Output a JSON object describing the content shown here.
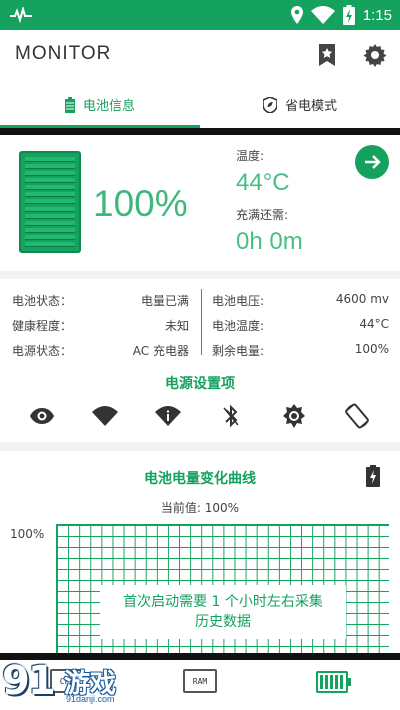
{
  "statusbar": {
    "time": "1:15"
  },
  "toolbar": {
    "app_title": "MONITOR"
  },
  "tabs": [
    {
      "label": "电池信息",
      "icon": "battery-icon",
      "active": true
    },
    {
      "label": "省电模式",
      "icon": "shield-leaf-icon",
      "active": false
    }
  ],
  "battery_card": {
    "level": "100%",
    "level_fraction": 1.0,
    "temp_label": "温度:",
    "temp_value": "44°C",
    "full_label": "充满还需:",
    "full_value": "0h 0m"
  },
  "info": {
    "left": [
      {
        "label": "电池状态：",
        "value": "电量已满"
      },
      {
        "label": "健康程度：",
        "value": "未知"
      },
      {
        "label": "电源状态：",
        "value": "AC 充电器"
      }
    ],
    "right": [
      {
        "label": "电池电压:",
        "value": "4600 mv"
      },
      {
        "label": "电池温度:",
        "value": "44°C"
      },
      {
        "label": "剩余电量:",
        "value": "100%"
      }
    ]
  },
  "power_settings": {
    "title": "电源设置项",
    "items": [
      "eye-icon",
      "wifi-icon",
      "wifi-info-icon",
      "bluetooth-icon",
      "brightness-icon",
      "auto-rotate-icon"
    ]
  },
  "chart": {
    "title": "电池电量变化曲线",
    "current": "当前值: 100%",
    "ylabel": "100%",
    "message_line1": "首次启动需要 1 个小时左右采集",
    "message_line2": "历史数据"
  },
  "bottom_nav": {
    "cpu": "CPU",
    "ram": "RAM"
  },
  "watermark": {
    "big": "91",
    "text": "游戏",
    "url": "91danji.com"
  },
  "colors": {
    "accent": "#15a15e",
    "accent_light": "#47bf83"
  }
}
